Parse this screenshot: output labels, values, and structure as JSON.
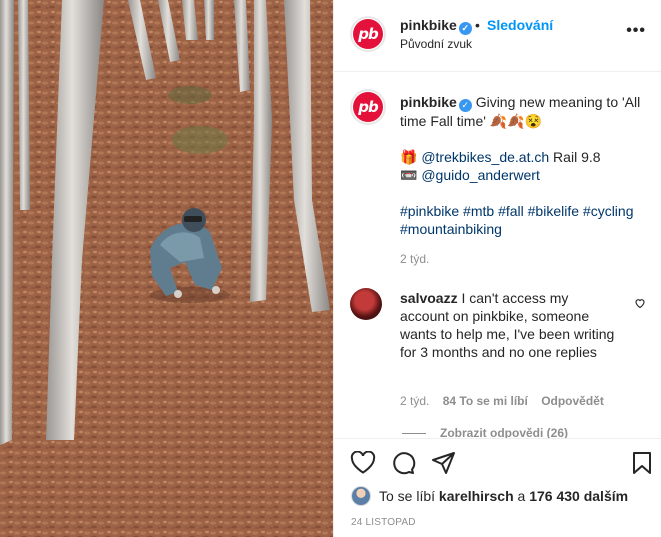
{
  "post": {
    "username": "pinkbike",
    "avatar_text": "pb",
    "dot": "•",
    "follow_label": "Sledování",
    "audio_label": "Původní zvuk"
  },
  "caption": {
    "username": "pinkbike",
    "line1": "Giving new meaning to 'All time Fall time' 🍂🍂😵",
    "gift_emoji": "🎁",
    "mention1": "@trekbikes_de.at.ch",
    "mention1_suffix": " Rail 9.8",
    "camera_emoji": "📼",
    "mention2": "@guido_anderwert",
    "tags": [
      "#pinkbike",
      "#mtb",
      "#fall",
      "#bikelife",
      "#cycling",
      "#mountainbiking"
    ],
    "time": "2 týd."
  },
  "comment": {
    "username": "salvoazz",
    "text": "I can't access my account on pinkbike, someone wants to help me, I've been writing for 3 months and no one replies",
    "time": "2 týd.",
    "likes": "84 To se mi líbí",
    "reply": "Odpovědět",
    "view_replies": "Zobrazit odpovědi (26)"
  },
  "likes": {
    "prefix": "To se líbí",
    "user": "karelhirsch",
    "middle": "a",
    "count": "176 430 dalším"
  },
  "date": "24 LISTOPAD",
  "icons": [
    "heart-icon",
    "comment-icon",
    "share-icon",
    "save-icon",
    "more-icon",
    "verified-icon"
  ],
  "colors": {
    "accent": "#0095f6",
    "brand": "#e4123a",
    "verified": "#3897f0"
  }
}
